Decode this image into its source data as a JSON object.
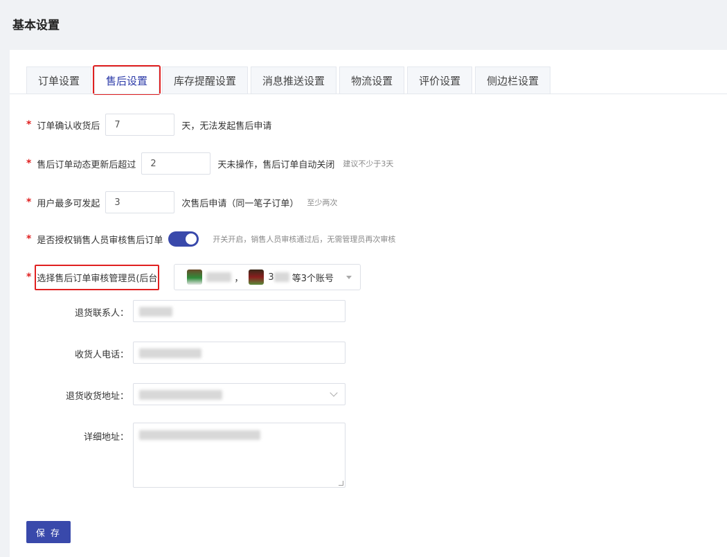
{
  "page": {
    "title": "基本设置"
  },
  "tabs": [
    {
      "label": "订单设置",
      "active": false
    },
    {
      "label": "售后设置",
      "active": true
    },
    {
      "label": "库存提醒设置",
      "active": false
    },
    {
      "label": "消息推送设置",
      "active": false
    },
    {
      "label": "物流设置",
      "active": false
    },
    {
      "label": "评价设置",
      "active": false
    },
    {
      "label": "侧边栏设置",
      "active": false
    }
  ],
  "form": {
    "confirm_days": {
      "required": "*",
      "label": "订单确认收货后",
      "value": "7",
      "suffix": "天，无法发起售后申请"
    },
    "auto_close": {
      "required": "*",
      "label": "售后订单动态更新后超过",
      "value": "2",
      "suffix": "天未操作，售后订单自动关闭",
      "hint": "建议不少于3天"
    },
    "max_apply": {
      "required": "*",
      "label": "用户最多可发起",
      "value": "3",
      "suffix": "次售后申请（同一笔子订单）",
      "hint": "至少两次"
    },
    "sales_review": {
      "required": "*",
      "label": "是否授权销售人员审核售后订单",
      "enabled": true,
      "hint": "开关开启，销售人员审核通过后，无需管理员再次审核"
    },
    "reviewers": {
      "required": "*",
      "label": "选择售后订单审核管理员(后台",
      "separator": "，",
      "partial_name": "3",
      "summary": "等3个账号"
    },
    "return_contact": {
      "label": "退货联系人："
    },
    "receiver_phone": {
      "label": "收货人电话："
    },
    "return_address": {
      "label": "退货收货地址："
    },
    "detail_address": {
      "label": "详细地址："
    }
  },
  "actions": {
    "save_label": "保 存"
  },
  "colors": {
    "primary": "#3949ab",
    "required": "#e02020",
    "highlight_border": "#e02020"
  }
}
